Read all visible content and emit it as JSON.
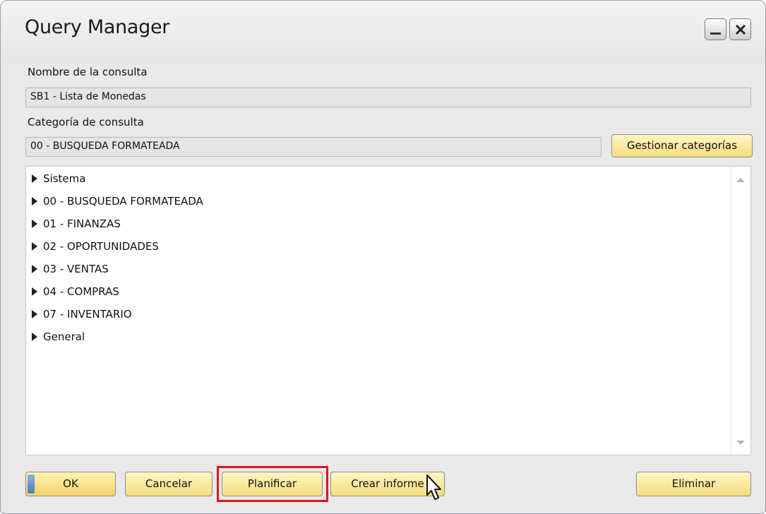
{
  "window": {
    "title": "Query Manager"
  },
  "query_name": {
    "label": "Nombre de la consulta",
    "value": "SB1 - Lista de Monedas"
  },
  "query_category": {
    "label": "Categoría de consulta",
    "value": "00 - BUSQUEDA FORMATEADA",
    "manage_button": "Gestionar categorías"
  },
  "tree": {
    "items": [
      "Sistema",
      "00 - BUSQUEDA FORMATEADA",
      "01 - FINANZAS",
      "02 - OPORTUNIDADES",
      "03 - VENTAS",
      "04 - COMPRAS",
      "07 - INVENTARIO",
      "General"
    ]
  },
  "buttons": {
    "ok": "OK",
    "cancel": "Cancelar",
    "schedule": "Planificar",
    "create_report": "Crear informe",
    "delete": "Eliminar"
  },
  "colors": {
    "button_top": "#fff5c4",
    "button_bottom": "#f6dd7e",
    "highlight": "#e0161e"
  },
  "icons": [
    "minimize-icon",
    "close-icon",
    "expand-arrow-icon",
    "scroll-up-icon",
    "scroll-down-icon",
    "mouse-cursor-icon"
  ]
}
